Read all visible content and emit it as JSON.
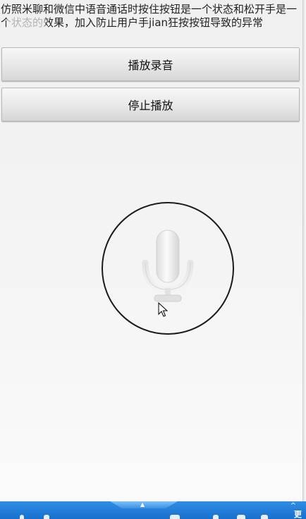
{
  "description": "仿照米聊和微信中语音通话时按住按钮是一个状态和松开手是一个状态的效果，加入防止用户手jian狂按按钮导致的异常",
  "buttons": {
    "play_label": "播放录音",
    "stop_label": "停止播放"
  },
  "record": {
    "icon": "microphone-icon",
    "ring_color": "#1a1a1a"
  },
  "taskbar": {
    "color": "#1a6fcf",
    "tab_caret": "▲",
    "tray_up": "^",
    "tray_text": "更"
  }
}
